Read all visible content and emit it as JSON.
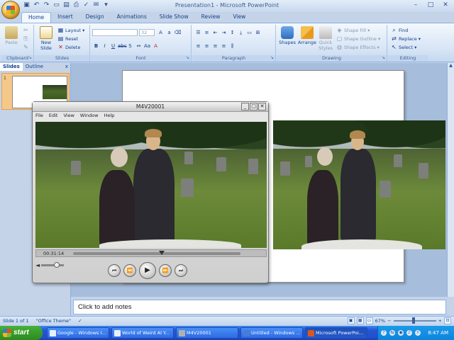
{
  "app": {
    "title": "Presentation1 - Microsoft PowerPoint",
    "window_controls": [
      "–",
      "□",
      "✕"
    ],
    "quick_access_icons": [
      "save-icon",
      "undo-icon",
      "redo-icon",
      "new-icon",
      "open-icon",
      "print-preview-icon",
      "spelling-icon",
      "email-icon",
      "customize-icon"
    ]
  },
  "tabs": [
    "Home",
    "Insert",
    "Design",
    "Animations",
    "Slide Show",
    "Review",
    "View"
  ],
  "active_tab": "Home",
  "ribbon": {
    "clipboard": {
      "label": "Clipboard",
      "paste": "Paste"
    },
    "slides": {
      "label": "Slides",
      "new_slide": "New Slide",
      "layout": "Layout",
      "reset": "Reset",
      "delete": "Delete"
    },
    "font": {
      "label": "Font",
      "font_size": "32"
    },
    "paragraph": {
      "label": "Paragraph"
    },
    "drawing": {
      "label": "Drawing",
      "shapes": "Shapes",
      "arrange": "Arrange",
      "quick_styles": "Quick Styles",
      "shape_fill": "Shape Fill",
      "shape_outline": "Shape Outline",
      "shape_effects": "Shape Effects"
    },
    "editing": {
      "label": "Editing",
      "find": "Find",
      "replace": "Replace",
      "select": "Select"
    }
  },
  "left_pane": {
    "tabs": [
      "Slides",
      "Outline"
    ],
    "active": "Slides",
    "close": "x",
    "slide_number": "1"
  },
  "slide": {
    "partial_text": "C"
  },
  "quicktime": {
    "title": "M4V20001",
    "menu": [
      "File",
      "Edit",
      "View",
      "Window",
      "Help"
    ],
    "timecode": "00:31:14",
    "playhead_fraction": 0.53,
    "buttons": [
      "go-to-start",
      "rewind",
      "play",
      "fast-forward",
      "go-to-end"
    ]
  },
  "notes": {
    "text": "Click to add notes"
  },
  "status": {
    "slide_info": "Slide 1 of 1",
    "theme": "\"Office Theme\"",
    "zoom": "67%"
  },
  "taskbar": {
    "start": "start",
    "tasks": [
      {
        "label": "Google - Windows I...",
        "icon_color": "#e8f0ff",
        "active": false
      },
      {
        "label": "World of Weird Al Y...",
        "icon_color": "#e8f0ff",
        "active": false
      },
      {
        "label": "M4V20001",
        "icon_color": "#b0b0b0",
        "active": false
      },
      {
        "label": "Untitled - Windows ...",
        "icon_color": "#4a7ad8",
        "active": false
      },
      {
        "label": "Microsoft PowerPoi...",
        "icon_color": "#d85820",
        "active": true
      }
    ],
    "clock": "8:47 AM"
  },
  "colors": {
    "ribbon_bg": "#dbe7f6",
    "taskbar_blue": "#2457d6",
    "start_green": "#3a9f2d",
    "slide_thumb_highlight": "#f5c889"
  }
}
